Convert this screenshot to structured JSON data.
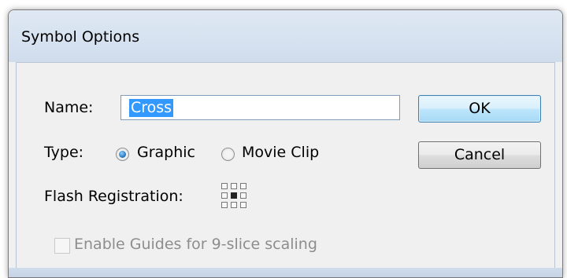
{
  "dialog": {
    "title": "Symbol Options"
  },
  "form": {
    "name_label": "Name:",
    "name_value": "Cross",
    "type_label": "Type:",
    "type_options": [
      {
        "label": "Graphic",
        "selected": true
      },
      {
        "label": "Movie Clip",
        "selected": false
      }
    ],
    "registration_label": "Flash Registration:",
    "registration_selected": "center",
    "guides_label": "Enable Guides for 9-slice scaling",
    "guides_checked": false,
    "guides_enabled": false
  },
  "buttons": {
    "ok_label": "OK",
    "cancel_label": "Cancel"
  }
}
